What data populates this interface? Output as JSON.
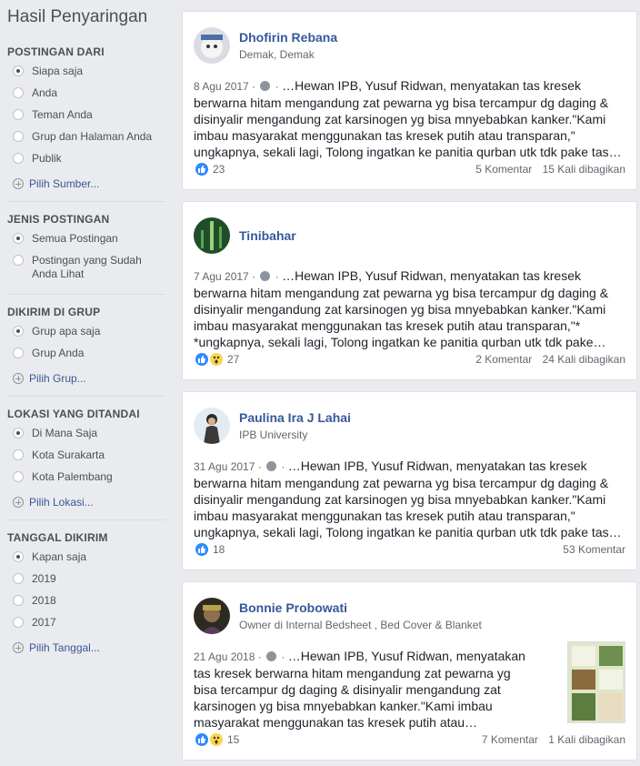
{
  "sidebar": {
    "title": "Hasil Penyaringan",
    "sections": [
      {
        "heading": "POSTINGAN DARI",
        "options": [
          {
            "label": "Siapa saja",
            "selected": true
          },
          {
            "label": "Anda",
            "selected": false
          },
          {
            "label": "Teman Anda",
            "selected": false
          },
          {
            "label": "Grup dan Halaman Anda",
            "selected": false
          },
          {
            "label": "Publik",
            "selected": false
          }
        ],
        "more": "Pilih Sumber..."
      },
      {
        "heading": "JENIS POSTINGAN",
        "options": [
          {
            "label": "Semua Postingan",
            "selected": true
          },
          {
            "label": "Postingan yang Sudah Anda Lihat",
            "selected": false
          }
        ]
      },
      {
        "heading": "DIKIRIM DI GRUP",
        "options": [
          {
            "label": "Grup apa saja",
            "selected": true
          },
          {
            "label": "Grup Anda",
            "selected": false
          }
        ],
        "more": "Pilih Grup..."
      },
      {
        "heading": "LOKASI YANG DITANDAI",
        "options": [
          {
            "label": "Di Mana Saja",
            "selected": true
          },
          {
            "label": "Kota Surakarta",
            "selected": false
          },
          {
            "label": "Kota Palembang",
            "selected": false
          }
        ],
        "more": "Pilih Lokasi..."
      },
      {
        "heading": "TANGGAL DIKIRIM",
        "options": [
          {
            "label": "Kapan saja",
            "selected": true
          },
          {
            "label": "2019",
            "selected": false
          },
          {
            "label": "2018",
            "selected": false
          },
          {
            "label": "2017",
            "selected": false
          }
        ],
        "more": "Pilih Tanggal..."
      }
    ]
  },
  "posts": [
    {
      "author": "Dhofirin Rebana",
      "subtitle": "Demak, Demak",
      "date": "8 Agu 2017",
      "text": "…Hewan IPB, Yusuf Ridwan, menyatakan tas kresek berwarna hitam mengandung zat pewarna yg bisa tercampur dg daging & disinyalir mengandung zat karsinogen yg bisa mnyebabkan kanker.\"Kami imbau masyarakat menggunakan tas kresek putih atau transparan,\" ungkapnya, sekali lagi, Tolong ingatkan ke panitia qurban utk tdk pake tas…",
      "reactions": [
        "like"
      ],
      "reaction_count": "23",
      "comments": "5 Komentar",
      "shares": "15 Kali dibagikan"
    },
    {
      "author": "Tinibahar",
      "subtitle": "",
      "date": "7 Agu 2017",
      "text": "…Hewan IPB, Yusuf Ridwan, menyatakan tas kresek berwarna hitam mengandung zat pewarna yg bisa tercampur dg daging & disinyalir mengandung zat karsinogen yg bisa mnyebabkan kanker.\"Kami imbau masyarakat menggunakan tas kresek putih atau transparan,\"* *ungkapnya, sekali lagi, Tolong ingatkan ke panitia qurban utk tdk pake…",
      "reactions": [
        "like",
        "wow"
      ],
      "reaction_count": "27",
      "comments": "2 Komentar",
      "shares": "24 Kali dibagikan"
    },
    {
      "author": "Paulina Ira J Lahai",
      "subtitle": "IPB University",
      "date": "31 Agu 2017",
      "text": "…Hewan IPB, Yusuf Ridwan, menyatakan tas kresek berwarna hitam mengandung zat pewarna yg bisa tercampur dg daging & disinyalir mengandung zat karsinogen yg bisa mnyebabkan kanker.\"Kami imbau masyarakat menggunakan tas kresek putih atau transparan,\" ungkapnya, sekali lagi, Tolong ingatkan ke panitia qurban utk tdk pake tas…",
      "reactions": [
        "like"
      ],
      "reaction_count": "18",
      "comments": "53 Komentar",
      "shares": ""
    },
    {
      "author": "Bonnie Probowati",
      "subtitle": "Owner di Internal Bedsheet , Bed Cover & Blanket",
      "date": "21 Agu 2018",
      "text": "…Hewan IPB, Yusuf Ridwan, menyatakan tas kresek berwarna hitam mengandung zat pewarna yg bisa tercampur dg daging & disinyalir mengandung zat karsinogen yg bisa mnyebabkan kanker.\"Kami imbau masyarakat menggunakan tas kresek putih atau…",
      "reactions": [
        "like",
        "wow"
      ],
      "reaction_count": "15",
      "comments": "7 Komentar",
      "shares": "1 Kali dibagikan"
    }
  ],
  "colors": {
    "link": "#365899",
    "like": "#2e89ff",
    "background": "#e9ebee"
  }
}
